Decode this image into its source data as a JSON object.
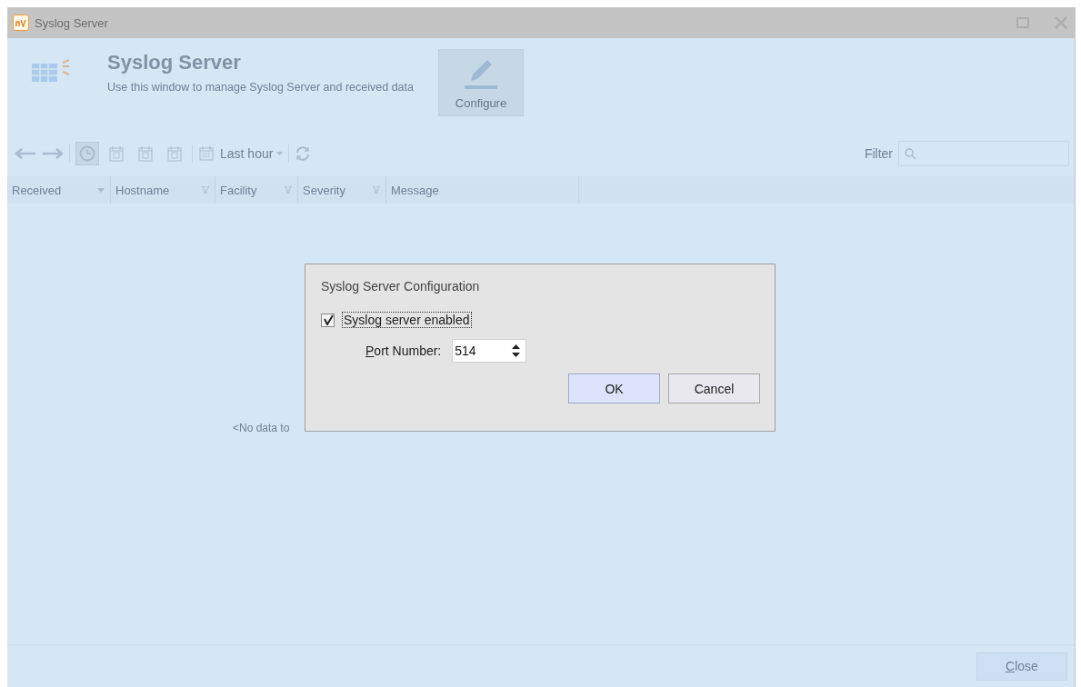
{
  "window": {
    "title": "Syslog Server"
  },
  "header": {
    "title": "Syslog Server",
    "subtitle": "Use this window to manage Syslog Server and received data",
    "configure_button": "Configure"
  },
  "toolbar": {
    "period_buttons": [
      {
        "kind": "clock",
        "selected": true
      },
      {
        "kind": "day",
        "selected": false
      },
      {
        "kind": "week",
        "selected": false
      },
      {
        "kind": "month",
        "selected": false
      }
    ],
    "range": "Last hour",
    "filter_label": "Filter"
  },
  "table": {
    "columns": [
      {
        "label": "Received",
        "kind": "sort"
      },
      {
        "label": "Hostname",
        "kind": "filter"
      },
      {
        "label": "Facility",
        "kind": "filter"
      },
      {
        "label": "Severity",
        "kind": "filter"
      },
      {
        "label": "Message",
        "kind": "plain"
      }
    ],
    "empty_text": "<No data to"
  },
  "footer": {
    "close_button": "Close"
  },
  "dialog": {
    "title": "Syslog Server Configuration",
    "enabled_label": "Syslog server enabled",
    "enabled": true,
    "port_label": "Port Number:",
    "port_value": "514",
    "buttons": [
      {
        "label": "OK",
        "default": true
      },
      {
        "label": "Cancel",
        "default": false
      }
    ]
  }
}
